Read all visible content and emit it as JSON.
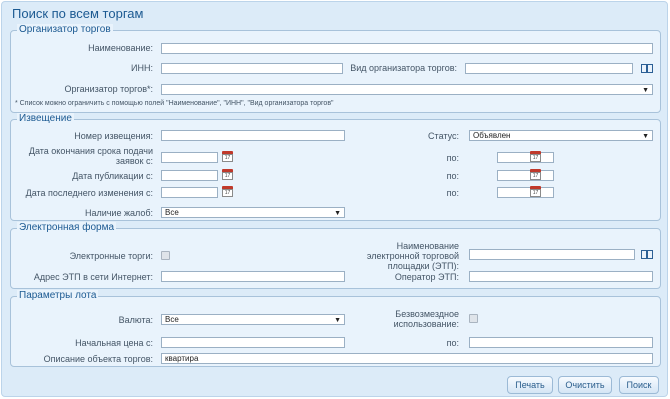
{
  "title": "Поиск по всем торгам",
  "organizer": {
    "legend": "Организатор торгов",
    "name_label": "Наименование:",
    "inn_label": "ИНН:",
    "type_label": "Вид организатора торгов:",
    "org_label": "Организатор торгов*:",
    "note": "* Список можно ограничить с помощью полей \"Наименование\", \"ИНН\", \"Вид организатора торгов\""
  },
  "notice": {
    "legend": "Извещение",
    "number_label": "Номер извещения:",
    "status_label": "Статус:",
    "status_value": "Объявлен",
    "deadline_label": "Дата окончания срока подачи заявок с:",
    "to_label": "по:",
    "pubdate_label": "Дата публикации с:",
    "changed_label": "Дата последнего изменения с:",
    "complaints_label": "Наличие жалоб:",
    "complaints_value": "Все"
  },
  "eform": {
    "legend": "Электронная форма",
    "etorgi_label": "Электронные торги:",
    "platform_label": "Наименование электронной торговой площадки (ЭТП):",
    "url_label": "Адрес ЭТП в сети Интернет:",
    "operator_label": "Оператор ЭТП:"
  },
  "lot": {
    "legend": "Параметры лота",
    "currency_label": "Валюта:",
    "currency_value": "Все",
    "free_label": "Безвозмездное использование:",
    "price_label": "Начальная цена с:",
    "to_label": "по:",
    "desc_label": "Описание объекта торгов:",
    "desc_value": "квартира"
  },
  "calendar_day": "17",
  "buttons": {
    "print": "Печать",
    "clear": "Очистить",
    "search": "Поиск"
  }
}
